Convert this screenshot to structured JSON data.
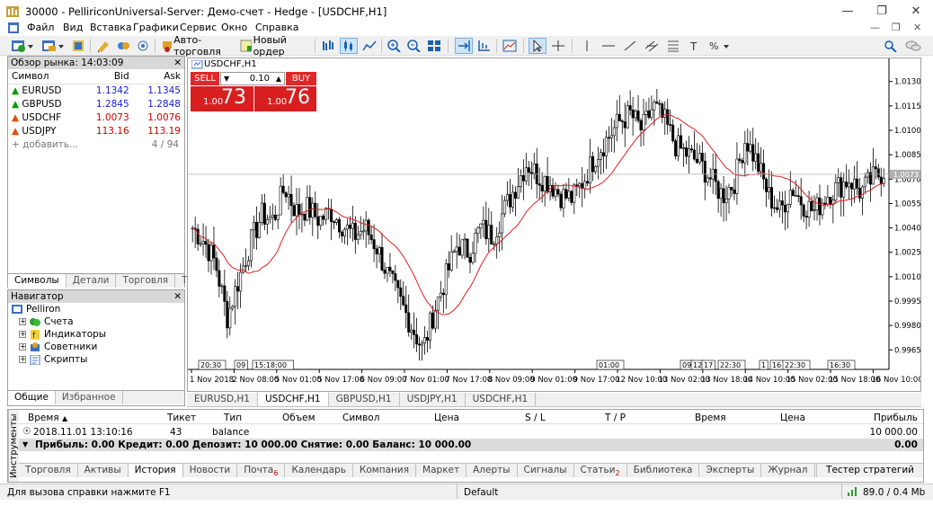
{
  "window": {
    "title": "30000 - PelliriconUniversal-Server: Демо-счет - Hedge - [USDCHF,H1]"
  },
  "menu": [
    "Файл",
    "Вид",
    "Вставка",
    "Графики",
    "Сервис",
    "Окно",
    "Справка"
  ],
  "toolbar": {
    "autotrade": "Авто-торговля",
    "neworder": "Новый ордер"
  },
  "market": {
    "title": "Обзор рынка: 14:03:09",
    "cols": [
      "Символ",
      "Bid",
      "Ask"
    ],
    "rows": [
      {
        "sym": "EURUSD",
        "bid": "1.1342",
        "ask": "1.1345",
        "dir": "up",
        "col": "blue"
      },
      {
        "sym": "GBPUSD",
        "bid": "1.2845",
        "ask": "1.2848",
        "dir": "up",
        "col": "blue"
      },
      {
        "sym": "USDCHF",
        "bid": "1.0073",
        "ask": "1.0076",
        "dir": "dn",
        "col": "red"
      },
      {
        "sym": "USDJPY",
        "bid": "113.16",
        "ask": "113.19",
        "dir": "dn",
        "col": "red"
      }
    ],
    "add": "+ добавить...",
    "count": "4 / 94",
    "tabs": [
      "Символы",
      "Детали",
      "Торговля",
      "Тики"
    ]
  },
  "navigator": {
    "title": "Навигатор",
    "root": "Pelliron",
    "items": [
      "Счета",
      "Индикаторы",
      "Советники",
      "Скрипты"
    ],
    "tabs": [
      "Общие",
      "Избранное"
    ]
  },
  "chart": {
    "label": "USDCHF,H1",
    "sell": "SELL",
    "buy": "BUY",
    "lot": "0.10",
    "sell_small": "1.00",
    "sell_big": "73",
    "buy_small": "1.00",
    "buy_big": "76",
    "price_tag": "1.0073"
  },
  "chart_data": {
    "type": "candlestick",
    "y_ticks": [
      "1.0130",
      "1.0115",
      "1.0100",
      "1.0085",
      "1.0070",
      "1.0055",
      "1.0040",
      "1.0025",
      "1.0010",
      "0.9995",
      "0.9980",
      "0.9965"
    ],
    "ylim": [
      0.9953,
      1.0142
    ],
    "x_labels": [
      "1 Nov 2018",
      "2 Nov 08:00",
      "5 Nov 01:00",
      "5 Nov 17:00",
      "6 Nov 09:00",
      "7 Nov 01:00",
      "7 Nov 17:00",
      "8 Nov 09:00",
      "9 Nov 01:00",
      "9 Nov 17:00",
      "12 Nov 10:00",
      "13 Nov 02:00",
      "13 Nov 18:00",
      "14 Nov 10:00",
      "15 Nov 02:00",
      "15 Nov 18:00",
      "16 Nov 10:00"
    ],
    "time_markers": [
      "20:30",
      "09",
      "15:18:00",
      "01:00",
      "09",
      "12",
      "17",
      "22:30",
      "1",
      "16",
      "22:30",
      "16:30"
    ],
    "close_points": [
      1.004,
      1.0032,
      1.0018,
      0.9985,
      1.0008,
      1.003,
      1.0048,
      1.0045,
      1.0065,
      1.005,
      1.0052,
      1.0045,
      1.005,
      1.0042,
      1.0035,
      1.004,
      1.0028,
      1.001,
      0.9995,
      0.998,
      0.9965,
      0.999,
      1.001,
      1.003,
      1.0025,
      1.004,
      1.0035,
      1.005,
      1.0065,
      1.008,
      1.0072,
      1.0068,
      1.006,
      1.0058,
      1.007,
      1.0085,
      1.0095,
      1.0105,
      1.011,
      1.01,
      1.0115,
      1.0105,
      1.009,
      1.0085,
      1.008,
      1.007,
      1.006,
      1.0068,
      1.0095,
      1.008,
      1.006,
      1.005,
      1.0065,
      1.0055,
      1.005,
      1.006,
      1.0065,
      1.007,
      1.0062,
      1.007,
      1.0075
    ]
  },
  "charttabs": [
    "EURUSD,H1",
    "USDCHF,H1",
    "GBPUSD,H1",
    "USDJPY,H1",
    "USDCHF,H1"
  ],
  "terminal": {
    "side": "Инструменты",
    "cols": [
      "Время",
      "Тикет",
      "Тип",
      "Объем",
      "Символ",
      "Цена",
      "S / L",
      "T / P",
      "Время",
      "Цена",
      "Прибыль"
    ],
    "row": {
      "time": "2018.11.01 13:10:16",
      "ticket": "43",
      "type": "balance",
      "profit": "10 000.00"
    },
    "balance": "Прибыль: 0.00  Кредит: 0.00  Депозит: 10 000.00  Снятие: 0.00  Баланс: 10 000.00",
    "balance_val": "0.00",
    "tabs": [
      "Торговля",
      "Активы",
      "История",
      "Новости",
      "Почта",
      "Календарь",
      "Компания",
      "Маркет",
      "Алерты",
      "Сигналы",
      "Статьи",
      "Библиотека",
      "Эксперты",
      "Журнал"
    ],
    "mail_badge": "6",
    "art_badge": "2",
    "tester": "Тестер стратегий"
  },
  "status": {
    "help": "Для вызова справки нажмите F1",
    "profile": "Default",
    "traffic": "89.0 / 0.4 Mb"
  }
}
